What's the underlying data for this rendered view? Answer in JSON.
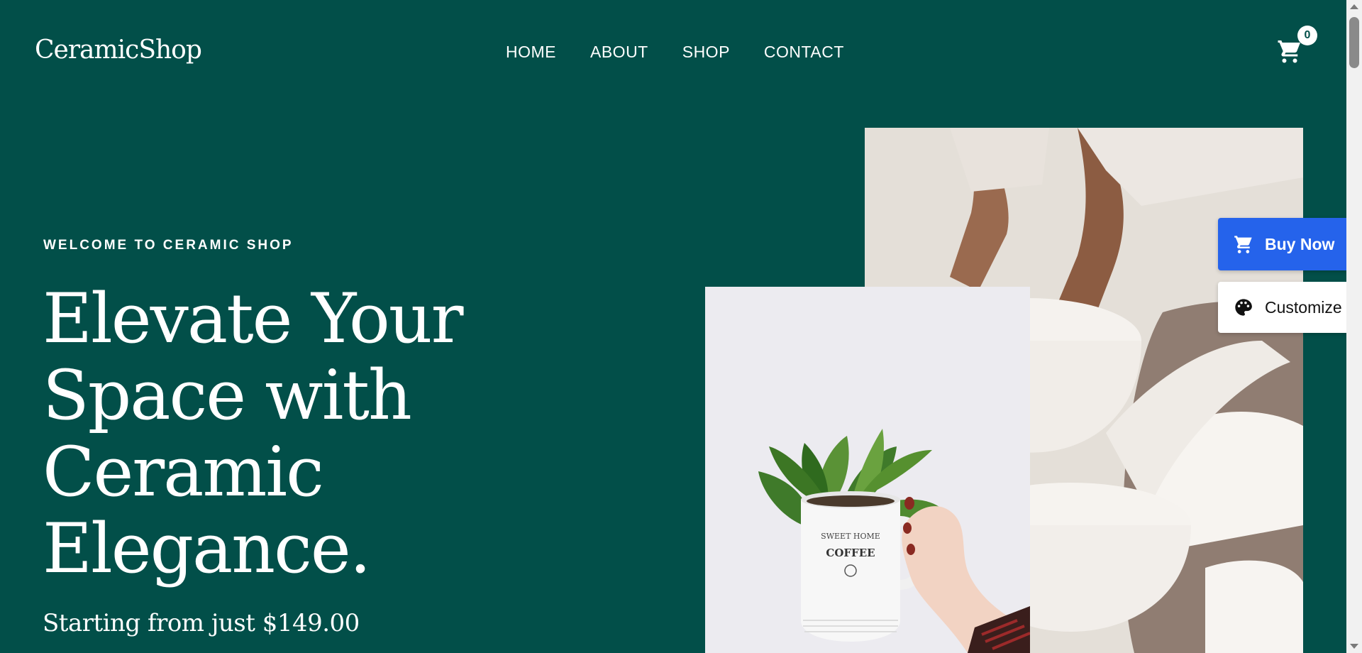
{
  "header": {
    "logo": "CeramicShop",
    "nav": [
      "HOME",
      "ABOUT",
      "SHOP",
      "CONTACT"
    ],
    "cart_count": "0",
    "cart_icon": "cart-icon"
  },
  "hero": {
    "eyebrow": "WELCOME TO CERAMIC SHOP",
    "headline": "Elevate Your Space with Ceramic Elegance.",
    "price_line": "Starting from just $149.00"
  },
  "mug_print": [
    "SWEET HOME",
    "COFFEE"
  ],
  "floating": {
    "buy_now": "Buy Now",
    "customize": "Customize",
    "buy_icon": "cart-icon",
    "customize_icon": "palette-icon",
    "buy_color": "#2563eb"
  },
  "colors": {
    "background": "#024f49",
    "text": "#ffffff"
  }
}
